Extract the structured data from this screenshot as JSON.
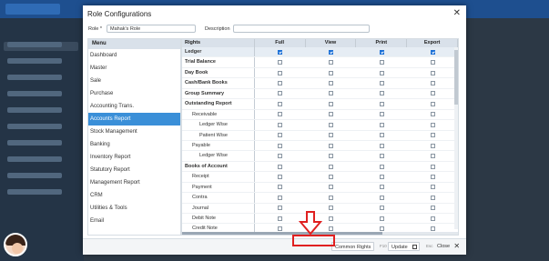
{
  "dialog": {
    "title": "Role Configurations",
    "close_glyph": "✕",
    "role_label": "Role *",
    "role_value": "Mahak's Role",
    "description_label": "Description",
    "description_value": ""
  },
  "menu": {
    "header": "Menu",
    "items": [
      {
        "label": "Dashboard"
      },
      {
        "label": "Master"
      },
      {
        "label": "Sale"
      },
      {
        "label": "Purchase"
      },
      {
        "label": "Accounting Trans."
      },
      {
        "label": "Accounts Report",
        "active": true
      },
      {
        "label": "Stock Management"
      },
      {
        "label": "Banking"
      },
      {
        "label": "Inventory Report"
      },
      {
        "label": "Statutory Report"
      },
      {
        "label": "Management Report"
      },
      {
        "label": "CRM"
      },
      {
        "label": "Utilities & Tools"
      },
      {
        "label": "Email"
      }
    ]
  },
  "rights": {
    "columns": [
      "Rights",
      "Full",
      "View",
      "Print",
      "Export"
    ],
    "rows": [
      {
        "name": "Ledger",
        "level": 0,
        "bold": true,
        "selected": true,
        "full": true,
        "view": true,
        "print": true,
        "export": true
      },
      {
        "name": "Trial Balance",
        "level": 0,
        "bold": true,
        "full": false,
        "view": false,
        "print": false,
        "export": false
      },
      {
        "name": "Day Book",
        "level": 0,
        "bold": true,
        "full": false,
        "view": false,
        "print": false,
        "export": false
      },
      {
        "name": "Cash/Bank Books",
        "level": 0,
        "bold": true,
        "full": false,
        "view": false,
        "print": false,
        "export": false
      },
      {
        "name": "Group Summary",
        "level": 0,
        "bold": true,
        "full": false,
        "view": false,
        "print": false,
        "export": false
      },
      {
        "name": "Outstanding Report",
        "level": 0,
        "bold": true,
        "full": false,
        "view": false,
        "print": false,
        "export": false
      },
      {
        "name": "Receivable",
        "level": 1,
        "full": false,
        "view": false,
        "print": false,
        "export": false
      },
      {
        "name": "Ledger Wise",
        "level": 2,
        "full": false,
        "view": false,
        "print": false,
        "export": false
      },
      {
        "name": "Patient Wise",
        "level": 2,
        "full": false,
        "view": false,
        "print": false,
        "export": false
      },
      {
        "name": "Payable",
        "level": 1,
        "full": false,
        "view": false,
        "print": false,
        "export": false
      },
      {
        "name": "Ledger Wise",
        "level": 2,
        "full": false,
        "view": false,
        "print": false,
        "export": false
      },
      {
        "name": "Books of Account",
        "level": 0,
        "bold": true,
        "full": false,
        "view": false,
        "print": false,
        "export": false
      },
      {
        "name": "Receipt",
        "level": 1,
        "full": false,
        "view": false,
        "print": false,
        "export": false
      },
      {
        "name": "Payment",
        "level": 1,
        "full": false,
        "view": false,
        "print": false,
        "export": false
      },
      {
        "name": "Contra",
        "level": 1,
        "full": false,
        "view": false,
        "print": false,
        "export": false
      },
      {
        "name": "Journal",
        "level": 1,
        "full": false,
        "view": false,
        "print": false,
        "export": false
      },
      {
        "name": "Debit Note",
        "level": 1,
        "full": false,
        "view": false,
        "print": false,
        "export": false
      },
      {
        "name": "Credit Note",
        "level": 1,
        "full": false,
        "view": false,
        "print": false,
        "export": false
      }
    ]
  },
  "footer": {
    "common_rights": "Common Rights",
    "update_key": "F10",
    "update_label": "Update",
    "close_key": "Esc",
    "close_label": "Close"
  },
  "annotation": {
    "color": "#e02020",
    "arrow_icon": "down-arrow-icon"
  }
}
